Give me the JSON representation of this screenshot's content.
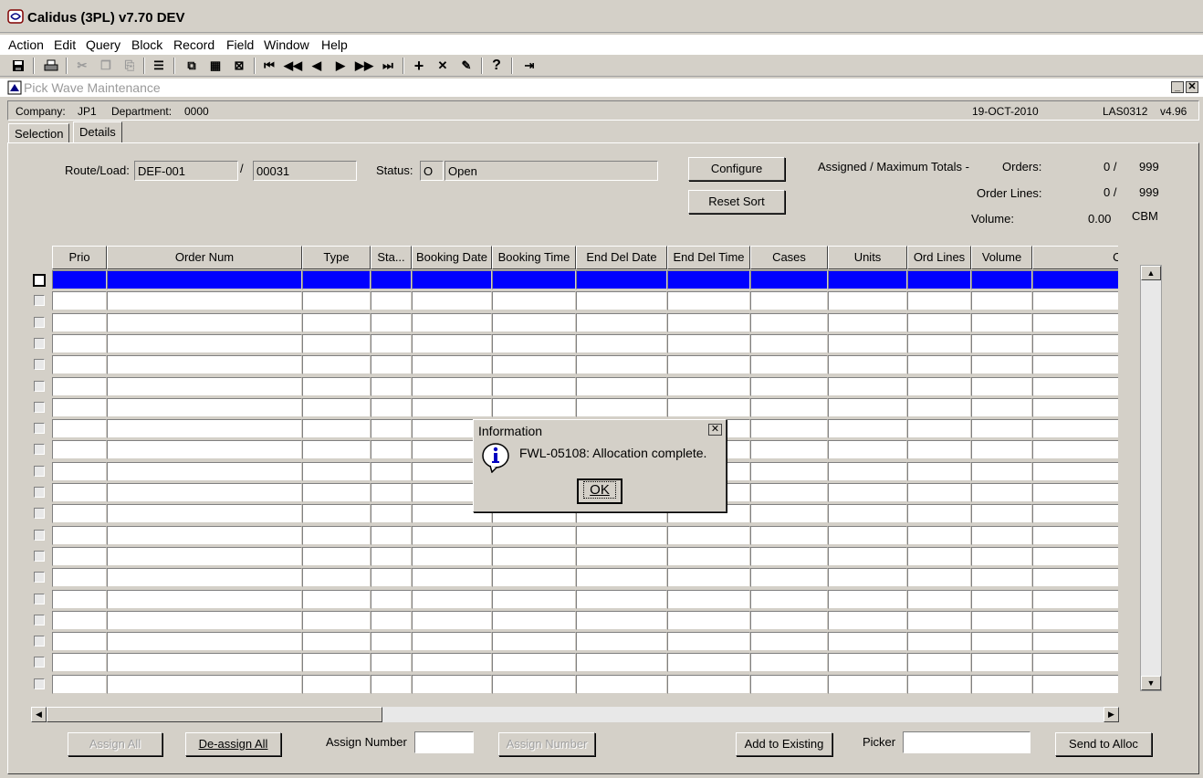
{
  "app": {
    "title": "Calidus (3PL) v7.70 DEV"
  },
  "menu": [
    "Action",
    "Edit",
    "Query",
    "Block",
    "Record",
    "Field",
    "Window",
    "Help"
  ],
  "window": {
    "title": "Pick Wave Maintenance"
  },
  "info": {
    "company_label": "Company:",
    "company": "JP1",
    "department_label": "Department:",
    "department": "0000",
    "date": "19-OCT-2010",
    "module": "LAS0312",
    "version": "v4.96"
  },
  "tabs": {
    "selection": "Selection",
    "details": "Details"
  },
  "form": {
    "route_load_label": "Route/Load:",
    "route": "DEF-001",
    "slash": "/",
    "load": "00031",
    "status_label": "Status:",
    "status_code": "O",
    "status_text": "Open",
    "configure": "Configure",
    "reset_sort": "Reset Sort",
    "totals_label": "Assigned / Maximum Totals -",
    "orders_label": "Orders:",
    "orders_assigned": "0 /",
    "orders_max": "999",
    "order_lines_label": "Order Lines:",
    "order_lines_assigned": "0 /",
    "order_lines_max": "999",
    "volume_label": "Volume:",
    "volume_value": "0.00",
    "volume_unit": "CBM"
  },
  "grid": {
    "columns": [
      "Prio",
      "Order Num",
      "Type",
      "Sta...",
      "Booking Date",
      "Booking Time",
      "End Del Date",
      "End Del Time",
      "Cases",
      "Units",
      "Ord Lines",
      "Volume",
      "Orde"
    ]
  },
  "bottom": {
    "assign_all": "Assign All",
    "deassign_all": "De-assign All",
    "assign_number_label": "Assign Number",
    "assign_number_btn": "Assign Number",
    "add_to_existing": "Add to Existing",
    "picker_label": "Picker",
    "send_to_alloc": "Send to Alloc"
  },
  "dialog": {
    "title": "Information",
    "message": "FWL-05108:  Allocation complete.",
    "ok": "OK"
  }
}
